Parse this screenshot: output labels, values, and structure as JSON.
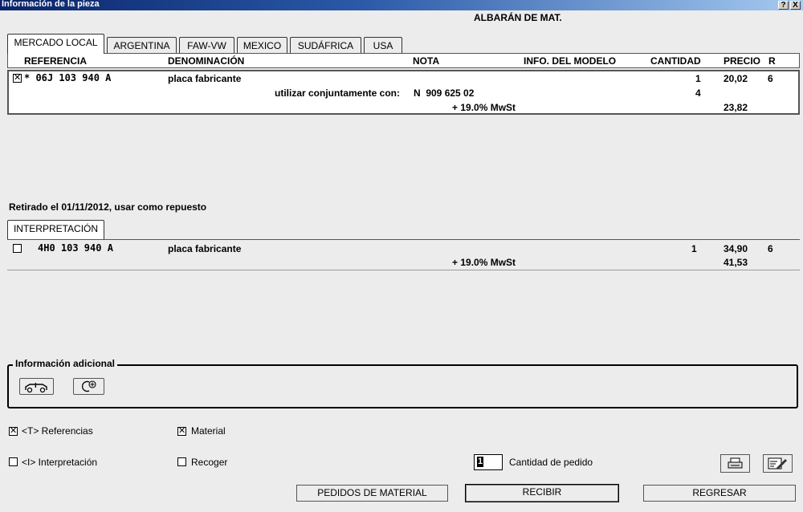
{
  "window": {
    "title": "Información de la pieza",
    "help_btn": "?",
    "close_btn": "X"
  },
  "header": {
    "label": "ALBARÁN DE MAT."
  },
  "tabs": [
    "MERCADO LOCAL",
    "ARGENTINA",
    "FAW-VW",
    "MEXICO",
    "SUDÁFRICA",
    "USA"
  ],
  "columns": {
    "referencia": "REFERENCIA",
    "denominacion": "DENOMINACIÓN",
    "nota": "NOTA",
    "info_modelo": "INFO. DEL MODELO",
    "cantidad": "CANTIDAD",
    "precio": "PRECIO",
    "r": "R"
  },
  "main_row": {
    "checked": true,
    "reference": "* 06J 103 940 A",
    "name": "placa fabricante",
    "qty": "1",
    "price": "20,02",
    "r": "6",
    "note_label": "utilizar conjuntamente con:",
    "note_value": "N  909 625 02",
    "note_qty": "4",
    "tax_label": "+ 19.0% MwSt",
    "tax_total": "23,82"
  },
  "retired_text": "Retirado el 01/11/2012, usar como repuesto",
  "interp_tab": "INTERPRETACIÓN",
  "interp_row": {
    "checked": false,
    "reference": "4H0 103 940 A",
    "name": "placa fabricante",
    "qty": "1",
    "price": "34,90",
    "r": "6",
    "tax_label": "+ 19.0% MwSt",
    "tax_total": "41,53"
  },
  "additional_info": {
    "legend": "Información adicional"
  },
  "options": {
    "referencias": "<T> Referencias",
    "material": "Material",
    "interpretacion": "<I> Interpretación",
    "recoger": "Recoger",
    "referencias_checked": true,
    "material_checked": true,
    "interpretacion_checked": false,
    "recoger_checked": false
  },
  "order_qty": {
    "value": "1",
    "label": "Cantidad de pedido"
  },
  "buttons": {
    "pedidos": "PEDIDOS DE MATERIAL",
    "recibir": "RECIBIR",
    "regresar": "REGRESAR"
  }
}
